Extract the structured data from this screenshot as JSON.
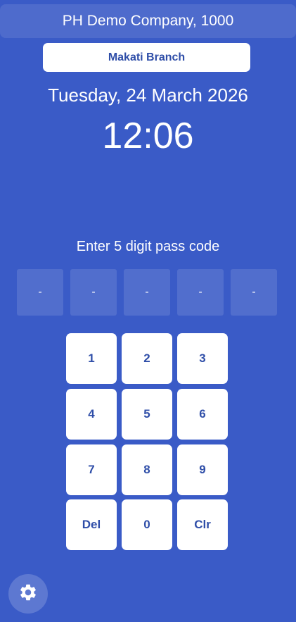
{
  "header": {
    "company": "PH Demo Company, 1000",
    "branch_button": "Makati Branch"
  },
  "clock": {
    "date": "Tuesday, 24 March 2026",
    "time": "12:06"
  },
  "passcode": {
    "prompt": "Enter 5 digit pass code",
    "digits": [
      "-",
      "-",
      "-",
      "-",
      "-"
    ]
  },
  "keypad": {
    "keys": [
      "1",
      "2",
      "3",
      "4",
      "5",
      "6",
      "7",
      "8",
      "9",
      "Del",
      "0",
      "Clr"
    ]
  },
  "footer": {
    "settings_icon": "gear-icon"
  },
  "colors": {
    "background": "#3a5bc7",
    "key_text": "#2f4ea8"
  }
}
